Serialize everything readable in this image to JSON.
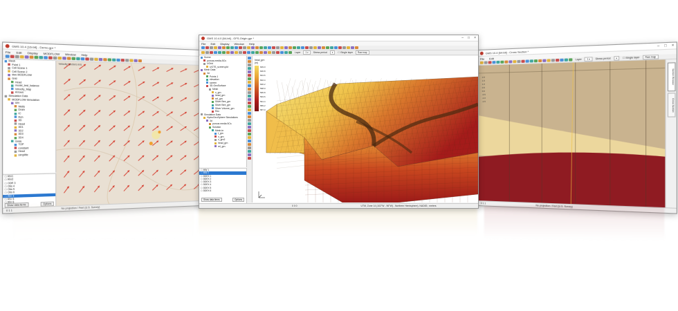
{
  "left_window": {
    "title": "GMS 10.4 [16-bit] - Demo.gpr *",
    "menu": [
      "File",
      "Edit",
      "Display",
      "MODFLOW",
      "Window",
      "Help"
    ],
    "tree": [
      "Mesh",
      "Point 1",
      "Cell Scene 1",
      "Cell Scene 2",
      "dwc-MODFLOW",
      "Grid",
      "Head",
      "model_test_balance",
      "Velocity_Map",
      "Arrows",
      "Simulation Data",
      "MODFLOW Simulation",
      "sim",
      "Wells",
      "Drain",
      "IC",
      "Rch",
      "3D",
      "Head",
      "3D1",
      "3D2",
      "3D3",
      "3D4",
      "Grids",
      "TOP",
      "constant",
      "Head",
      "simplifie"
    ],
    "list": [
      "RIV1",
      "RIV2",
      "ODR 3",
      "Obs 4",
      "Obs 5",
      "Obs 6",
      "RIV 4",
      "RIV 5",
      "RIV 6",
      "Obs 7",
      "RIV 8",
      "ODR 9"
    ],
    "show_button": "Show data items",
    "options_button": "Options",
    "status_coords": "0 1 1",
    "status_projection": "No projection / Feet (U.S. Survey)",
    "view_label": "Velocity Vectors m/s"
  },
  "center_window": {
    "title": "GMS 10.4.0 [64-bit] - GFS-Origin.gpr *",
    "menu": [
      "File",
      "Edit",
      "Display",
      "Window",
      "Help"
    ],
    "toolbar_layer": "Layer",
    "toolbar_stress": "Stress period",
    "toolbar_label_single": "Single layer",
    "toolbar_label_res": "Raw map",
    "tree": [
      "Scene",
      "porous-media-5Cs",
      "UGrid",
      "UGTS_screen.pkt",
      "Mesh Data",
      "3d",
      "Points 1",
      "elevation",
      "screen",
      "3D-GeoSurface",
      "Mesh",
      "x_grn",
      "head_grn",
      "ref_grn",
      "Silver Bee_grn",
      "Silver Bee_grn",
      "Silver Volume_grn",
      "Rec",
      "Simulation Data",
      "HydroGeoSphere Simulations",
      "3d",
      "porous media 5Cs",
      "Solution",
      "Mesh-tn",
      "t_grn",
      "x_grn",
      "x_grn2",
      "head_grn",
      "rel_grn"
    ],
    "list": [
      "MW 1",
      "MW 2",
      "DDEX 1",
      "DDEX 2",
      "DDEX 3",
      "DDEX 4",
      "DDEX 5",
      "DDEX 6"
    ],
    "show_button": "Show data items",
    "options_button": "Options",
    "legend_title": "head_grn",
    "legend_subtitle": "(m)",
    "legend_values": [
      "609.0",
      "606.8",
      "604.6",
      "602.4",
      "600.2",
      "598.0",
      "595.8",
      "593.6",
      "591.4",
      "589.2",
      "587.0"
    ],
    "status_coords": "0 0 0",
    "status_projection": "UTM, Zone 14 (102°W - 96°W) - Northern Hemisphere), NAD83 ; meters"
  },
  "right_window": {
    "title": "GMS 10.4 [64-bit] - Cross Section *",
    "menu": [
      "File",
      "Edit"
    ],
    "toolbar_layer": "Layer",
    "toolbar_stress": "Stress period",
    "toolbar_label_single": "Single layer",
    "toolbar_label_res": "Raw map",
    "side_tab": "Section Browser",
    "side_tab_2": "Cross Section",
    "legend_values": [
      "2.0",
      "1.5",
      "1.0",
      "0.5",
      "0.0",
      "-0.5",
      "-1.0",
      "-1.5"
    ],
    "status_coords": "0 1 1",
    "status_projection": "No projection / Feet (U.S. Survey)"
  },
  "colors": {
    "left_bg": "#e9e0d3",
    "arrow": "#d53b2c",
    "mesh_top_yellow": "#f3d65a",
    "mesh_red": "#b6251e",
    "xsec_tan": "#c9b38f",
    "xsec_light": "#ecd79d",
    "xsec_red": "#8f1b22",
    "selection": "#2b78d0"
  }
}
